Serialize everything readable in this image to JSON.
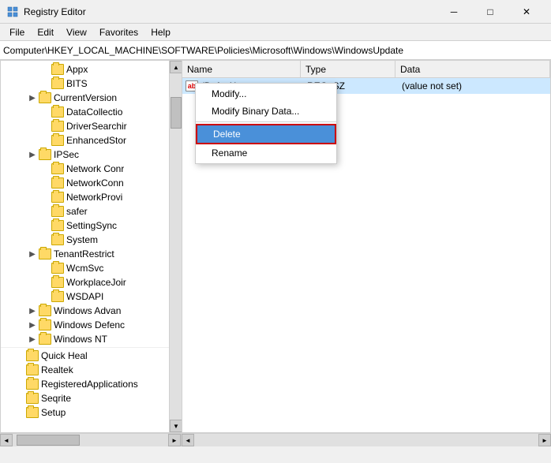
{
  "window": {
    "title": "Registry Editor",
    "icon": "registry-icon"
  },
  "titlebar": {
    "minimize": "─",
    "maximize": "□",
    "close": "✕"
  },
  "menubar": {
    "items": [
      "File",
      "Edit",
      "View",
      "Favorites",
      "Help"
    ]
  },
  "addressbar": {
    "path": "Computer\\HKEY_LOCAL_MACHINE\\SOFTWARE\\Policies\\Microsoft\\Windows\\WindowsUpdate"
  },
  "tree": {
    "items": [
      {
        "label": "Appx",
        "indent": 3,
        "toggle": "",
        "has_toggle": false
      },
      {
        "label": "BITS",
        "indent": 3,
        "toggle": "",
        "has_toggle": false
      },
      {
        "label": "CurrentVersion",
        "indent": 2,
        "toggle": "▶",
        "has_toggle": true
      },
      {
        "label": "DataCollectio",
        "indent": 3,
        "toggle": "",
        "has_toggle": false
      },
      {
        "label": "DriverSearchir",
        "indent": 3,
        "toggle": "",
        "has_toggle": false
      },
      {
        "label": "EnhancedStor",
        "indent": 3,
        "toggle": "",
        "has_toggle": false
      },
      {
        "label": "IPSec",
        "indent": 2,
        "toggle": "▶",
        "has_toggle": true
      },
      {
        "label": "Network Conr",
        "indent": 3,
        "toggle": "",
        "has_toggle": false
      },
      {
        "label": "NetworkConn",
        "indent": 3,
        "toggle": "",
        "has_toggle": false
      },
      {
        "label": "NetworkProvi",
        "indent": 3,
        "toggle": "",
        "has_toggle": false
      },
      {
        "label": "safer",
        "indent": 3,
        "toggle": "",
        "has_toggle": false
      },
      {
        "label": "SettingSync",
        "indent": 3,
        "toggle": "",
        "has_toggle": false
      },
      {
        "label": "System",
        "indent": 3,
        "toggle": "",
        "has_toggle": false
      },
      {
        "label": "TenantRestrict",
        "indent": 2,
        "toggle": "▶",
        "has_toggle": true
      },
      {
        "label": "WcmSvc",
        "indent": 3,
        "toggle": "",
        "has_toggle": false
      },
      {
        "label": "WorkplaceJoir",
        "indent": 3,
        "toggle": "",
        "has_toggle": false
      },
      {
        "label": "WSDAPI",
        "indent": 3,
        "toggle": "",
        "has_toggle": false
      },
      {
        "label": "Windows Advan",
        "indent": 2,
        "toggle": "▶",
        "has_toggle": true
      },
      {
        "label": "Windows Defenc",
        "indent": 2,
        "toggle": "▶",
        "has_toggle": true
      },
      {
        "label": "Windows NT",
        "indent": 2,
        "toggle": "▶",
        "has_toggle": true
      }
    ]
  },
  "tree_bottom": [
    {
      "label": "Quick Heal",
      "indent": 1,
      "toggle": "",
      "has_toggle": false
    },
    {
      "label": "Realtek",
      "indent": 1,
      "toggle": "",
      "has_toggle": false
    },
    {
      "label": "RegisteredApplications",
      "indent": 1,
      "toggle": "",
      "has_toggle": false
    },
    {
      "label": "Seqrite",
      "indent": 1,
      "toggle": "",
      "has_toggle": false
    },
    {
      "label": "Setup",
      "indent": 1,
      "toggle": "",
      "has_toggle": false
    }
  ],
  "list": {
    "columns": [
      "Name",
      "Type",
      "Data"
    ],
    "rows": [
      {
        "name": "(Default)",
        "type": "REG_SZ",
        "data": "(value not set)",
        "icon": "ab"
      }
    ]
  },
  "context_menu": {
    "items": [
      {
        "label": "Modify...",
        "active": false
      },
      {
        "label": "Modify Binary Data...",
        "active": false
      },
      {
        "label": "Delete",
        "active": true
      },
      {
        "label": "Rename",
        "active": false
      }
    ],
    "separator_after": 1
  },
  "status_bar": {
    "text": ""
  }
}
